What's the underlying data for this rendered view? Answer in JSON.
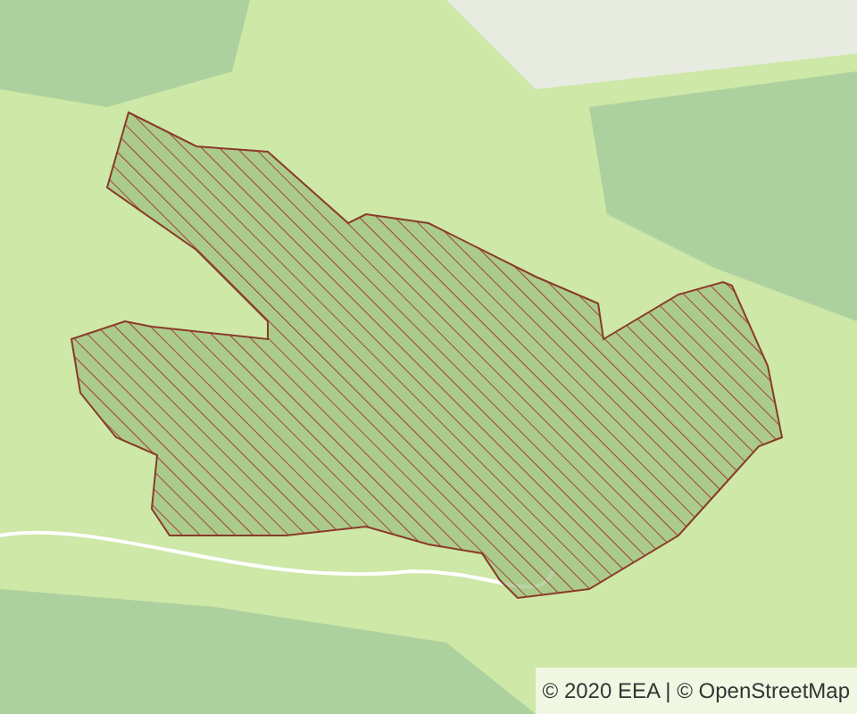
{
  "attribution": {
    "text": "© 2020 EEA | © OpenStreetMap"
  }
}
